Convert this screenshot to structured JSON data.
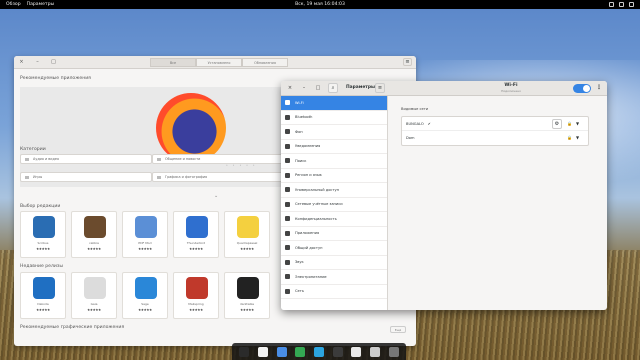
{
  "topbar": {
    "activities": "Обзор",
    "app_menu": "Параметры",
    "clock": "Вск, 19 мая 16:04:03"
  },
  "software": {
    "tabs": [
      "Все",
      "Установлено",
      "Обновления"
    ],
    "recommended_title": "Рекомендуемые приложения",
    "categories_title": "Категории",
    "categories": [
      "Аудио и видео",
      "Общение и новости",
      "Игры",
      "Графика и фотография"
    ],
    "editors_title": "Выбор редакции",
    "editors": [
      {
        "name": "Scribus",
        "stars": "★★★★★",
        "color": "#2a6db3"
      },
      {
        "name": "calibre",
        "stars": "★★★★★",
        "color": "#6b4b2d"
      },
      {
        "name": "PDF Mod",
        "stars": "★★★★★",
        "color": "#5b8fd6"
      },
      {
        "name": "Thunderbird",
        "stars": "★★★★★",
        "color": "#2f6fcf"
      },
      {
        "name": "Quadrapassel",
        "stars": "★★★★★",
        "color": "#f4d03f"
      }
    ],
    "recent_title": "Недавние релизы",
    "recent": [
      {
        "name": "Dakoda",
        "stars": "★★★★★",
        "color": "#1f6fc2"
      },
      {
        "name": "Gaia",
        "stars": "★★★★★",
        "color": "#dcdcdc"
      },
      {
        "name": "Sage",
        "stars": "★★★★★",
        "color": "#2a87d8"
      },
      {
        "name": "Mailspring",
        "stars": "★★★★★",
        "color": "#c0392b"
      },
      {
        "name": "darktable",
        "stars": "★★★★★",
        "color": "#222222"
      }
    ],
    "graphics_title": "Рекомендуемые графические приложения",
    "more_label": "Ещё"
  },
  "settings": {
    "search_title": "Параметры",
    "title": "Wi-Fi",
    "subtitle": "Подключено",
    "sidebar": [
      "Wi-Fi",
      "Bluetooth",
      "Фон",
      "Уведомления",
      "Поиск",
      "Регион и язык",
      "Универсальный доступ",
      "Сетевые учётные записи",
      "Конфиденциальность",
      "Приложения",
      "Общий доступ",
      "Звук",
      "Электропитание",
      "Сеть"
    ],
    "networks_label": "Видимые сети",
    "networks": [
      {
        "name": "BUNGALO",
        "connected": "✔"
      },
      {
        "name": "Dom",
        "connected": ""
      }
    ]
  },
  "dock": [
    "#2b2b2b",
    "#f2f2f2",
    "#4a8ee6",
    "#34a853",
    "#2ca5e0",
    "#3b3b3b",
    "#e8e8e8",
    "#cccccc",
    "#777777"
  ]
}
